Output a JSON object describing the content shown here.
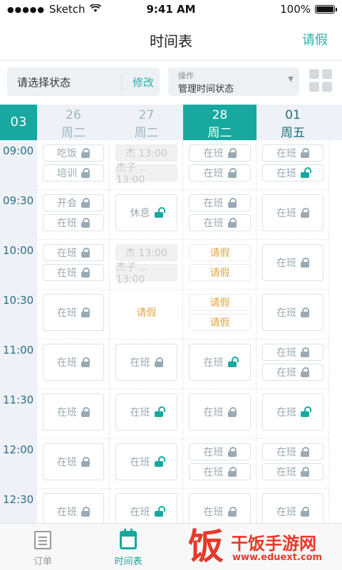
{
  "status_bar": {
    "carrier": "Sketch",
    "time": "9:41 AM",
    "battery": "100%"
  },
  "navbar": {
    "title": "时间表",
    "action": "请假"
  },
  "filter": {
    "status_placeholder": "请选择状态",
    "edit": "修改",
    "op_label": "操作",
    "op_value": "管理时间状态"
  },
  "calendar": {
    "month": "03",
    "days": [
      {
        "num": "26",
        "week": "周二",
        "kind": "past"
      },
      {
        "num": "27",
        "week": "周二",
        "kind": "past"
      },
      {
        "num": "28",
        "week": "周二",
        "kind": "today"
      },
      {
        "num": "01",
        "week": "周五",
        "kind": "future"
      }
    ],
    "times": [
      "09:00",
      "09:30",
      "10:00",
      "10:30",
      "11:00",
      "11:30",
      "12:00",
      "12:30"
    ],
    "cells": [
      [
        [
          {
            "t": "吃饭",
            "lock": "closed"
          },
          {
            "t": "培训",
            "lock": "closed"
          }
        ],
        [
          {
            "t": "开会",
            "lock": "closed"
          },
          {
            "t": "在班",
            "lock": "closed"
          }
        ],
        [
          {
            "t": "在班",
            "lock": "closed"
          },
          {
            "t": "在班",
            "lock": "closed"
          }
        ],
        [
          {
            "t": "在班",
            "lock": "closed"
          }
        ],
        [
          {
            "t": "在班",
            "lock": "closed"
          }
        ],
        [
          {
            "t": "在班",
            "lock": "closed"
          }
        ],
        [
          {
            "t": "在班",
            "lock": "closed"
          }
        ],
        [
          {
            "t": "在班",
            "lock": "closed"
          }
        ]
      ],
      [
        [
          {
            "t": "杰 13:00",
            "style": "gray"
          },
          {
            "t": "杰子 .. 13:00",
            "style": "gray"
          }
        ],
        [
          {
            "t": "休息",
            "lock": "open"
          }
        ],
        [
          {
            "t": "杰 13:00",
            "style": "gray"
          },
          {
            "t": "杰子 .. 13:00",
            "style": "gray"
          }
        ],
        [
          {
            "t": "请假",
            "style": "orange-plain"
          }
        ],
        [
          {
            "t": "在班",
            "lock": "closed"
          }
        ],
        [
          {
            "t": "在班",
            "lock": "open"
          }
        ],
        [
          {
            "t": "在班",
            "lock": "open"
          }
        ],
        [
          {
            "t": "在班",
            "lock": "open"
          }
        ]
      ],
      [
        [
          {
            "t": "在班",
            "lock": "closed"
          },
          {
            "t": "在班",
            "lock": "closed"
          }
        ],
        [
          {
            "t": "在班",
            "lock": "closed"
          },
          {
            "t": "在班",
            "lock": "closed"
          }
        ],
        [
          {
            "t": "请假",
            "style": "orange"
          },
          {
            "t": "请假",
            "style": "orange"
          }
        ],
        [
          {
            "t": "请假",
            "style": "orange"
          },
          {
            "t": "请假",
            "style": "orange"
          }
        ],
        [
          {
            "t": "在班",
            "lock": "open"
          }
        ],
        [
          {
            "t": "在班",
            "lock": "closed"
          }
        ],
        [
          {
            "t": "在班",
            "lock": "closed"
          },
          {
            "t": "在班",
            "lock": "closed"
          }
        ],
        [
          {
            "t": "在班",
            "lock": "closed"
          }
        ]
      ],
      [
        [
          {
            "t": "在班",
            "lock": "closed"
          },
          {
            "t": "在班",
            "lock": "open"
          }
        ],
        [
          {
            "t": "在班",
            "lock": "closed"
          }
        ],
        [
          {
            "t": "在班",
            "lock": "closed"
          }
        ],
        [
          {
            "t": "在班",
            "lock": "closed"
          }
        ],
        [
          {
            "t": "在班",
            "lock": "closed"
          },
          {
            "t": "在班",
            "lock": "closed"
          }
        ],
        [
          {
            "t": "在班",
            "lock": "open"
          }
        ],
        [
          {
            "t": "在班",
            "lock": "closed"
          },
          {
            "t": "在班",
            "lock": "closed"
          }
        ],
        [
          {
            "t": "在班",
            "lock": "closed"
          }
        ]
      ]
    ]
  },
  "tabbar": {
    "tabs": [
      {
        "label": "订单",
        "icon": "document-icon"
      },
      {
        "label": "时间表",
        "icon": "calendar-icon"
      }
    ]
  },
  "watermark": {
    "logo_char": "饭",
    "title": "干饭手游网",
    "url": "www.eduext.com"
  },
  "colors": {
    "accent": "#17a89f",
    "orange": "#e0a845"
  }
}
